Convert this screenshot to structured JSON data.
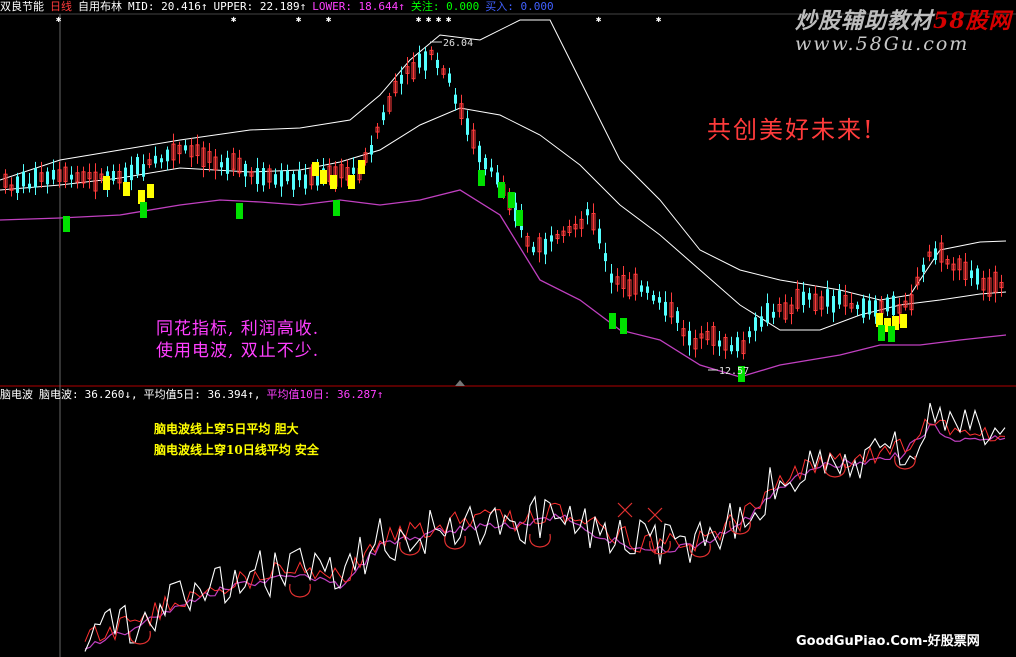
{
  "header": {
    "stock_name": "双良节能",
    "period": "日线",
    "indicator": "自用布林",
    "mid": "MID: 20.416↑",
    "upper": "UPPER: 22.189↑",
    "lower": "LOWER: 18.644↑",
    "focus": "关注: 0.000",
    "buy": "买入: 0.000"
  },
  "subpanel": {
    "title": "脑电波",
    "indicator_name": "脑电波:",
    "value": "36.260↓,",
    "ma5": "平均值5日: 36.394↑,",
    "ma10": "平均值10日: 36.287↑"
  },
  "annotations": {
    "watermark_line1": "炒股辅助教材",
    "watermark_line1_red": "58股网",
    "watermark_line2": "www.58Gu.com",
    "slogan": "共创美好未来!",
    "note_a1": "同花指标, 利润高收.",
    "note_a2": "使用电波, 双止不少.",
    "note_b1": "脑电波线上穿5日平均  胆大",
    "note_b2": "脑电波线上穿10日线平均 安全",
    "footer": "GoodGuPiao.Com-好股票网",
    "high_label": "26.04",
    "low_label": "12.57"
  },
  "colors": {
    "up": "#ff3b3b",
    "down": "#54ffff",
    "mid_line": "#ffffff",
    "lower_band": "#c040c0",
    "signal_yellow": "#ffff00",
    "signal_green": "#00e000",
    "wave_line": "#ffffff",
    "ma_line": "#ff3030",
    "header_mid": "#ffffff",
    "header_upper": "#ffffff",
    "header_lower": "#ff40ff",
    "header_focus": "#00ff00",
    "header_buy": "#4060ff"
  }
}
